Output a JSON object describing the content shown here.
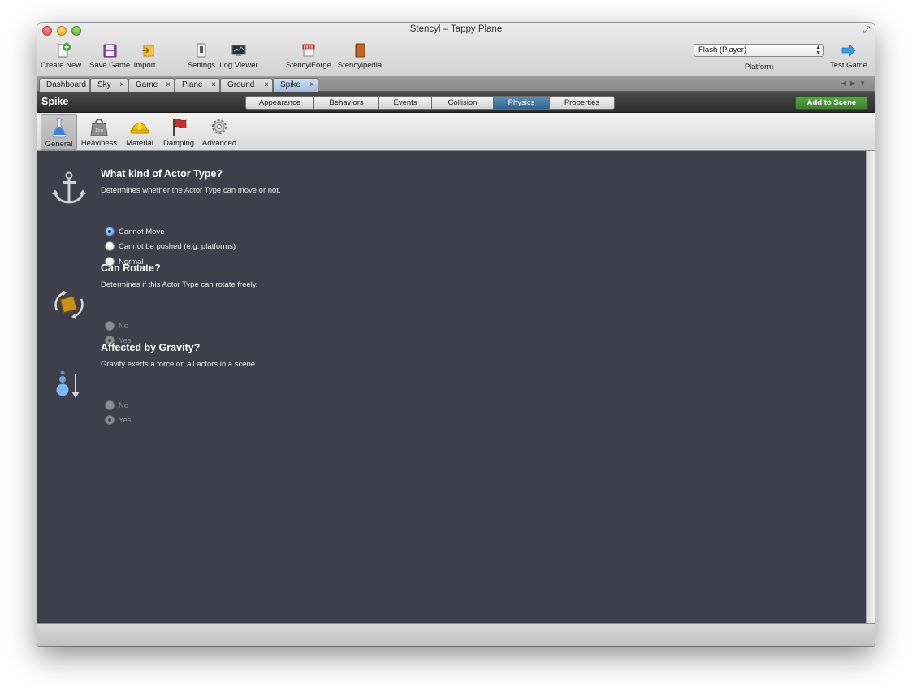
{
  "window": {
    "title": "Stencyl – Tappy Plane"
  },
  "toolbar": {
    "create_new": "Create New...",
    "save_game": "Save Game",
    "import": "Import...",
    "settings": "Settings",
    "log_viewer": "Log Viewer",
    "stencylforge": "StencylForge",
    "stencylpedia": "Stencylpedia",
    "platform_value": "Flash (Player)",
    "platform_label": "Platform",
    "test_game": "Test Game"
  },
  "tabs": [
    {
      "label": "Dashboard"
    },
    {
      "label": "Sky",
      "close": "×"
    },
    {
      "label": "Game",
      "close": "×"
    },
    {
      "label": "Plane",
      "close": "×"
    },
    {
      "label": "Ground",
      "close": "×"
    },
    {
      "label": "Spike",
      "close": "×"
    }
  ],
  "actor": {
    "name": "Spike",
    "sections": [
      "Appearance",
      "Behaviors",
      "Events",
      "Collision",
      "Physics",
      "Properties"
    ],
    "active_section": "Physics",
    "add_to_scene": "Add to Scene"
  },
  "physics_tabs": [
    "General",
    "Heaviness",
    "Material",
    "Damping",
    "Advanced"
  ],
  "physics_active": "General",
  "general": {
    "actor_type": {
      "title": "What kind of Actor Type?",
      "desc": "Determines whether the Actor Type can move or not.",
      "options": [
        "Cannot Move",
        "Cannot be pushed (e.g. platforms)",
        "Normal"
      ],
      "selected": "Cannot Move"
    },
    "rotate": {
      "title": "Can Rotate?",
      "desc": "Determines if this Actor Type can rotate freely.",
      "options": [
        "No",
        "Yes"
      ],
      "selected": "Yes",
      "disabled": true
    },
    "gravity": {
      "title": "Affected by Gravity?",
      "desc": "Gravity exerts a force on all actors in a scene.",
      "options": [
        "No",
        "Yes"
      ],
      "selected": "Yes",
      "disabled": true
    }
  },
  "icon_badge": "1kg",
  "colors": {
    "content_bg": "#3e3f4a",
    "active_segment": "#3f6f98",
    "add_scene": "#4a8f3a"
  }
}
